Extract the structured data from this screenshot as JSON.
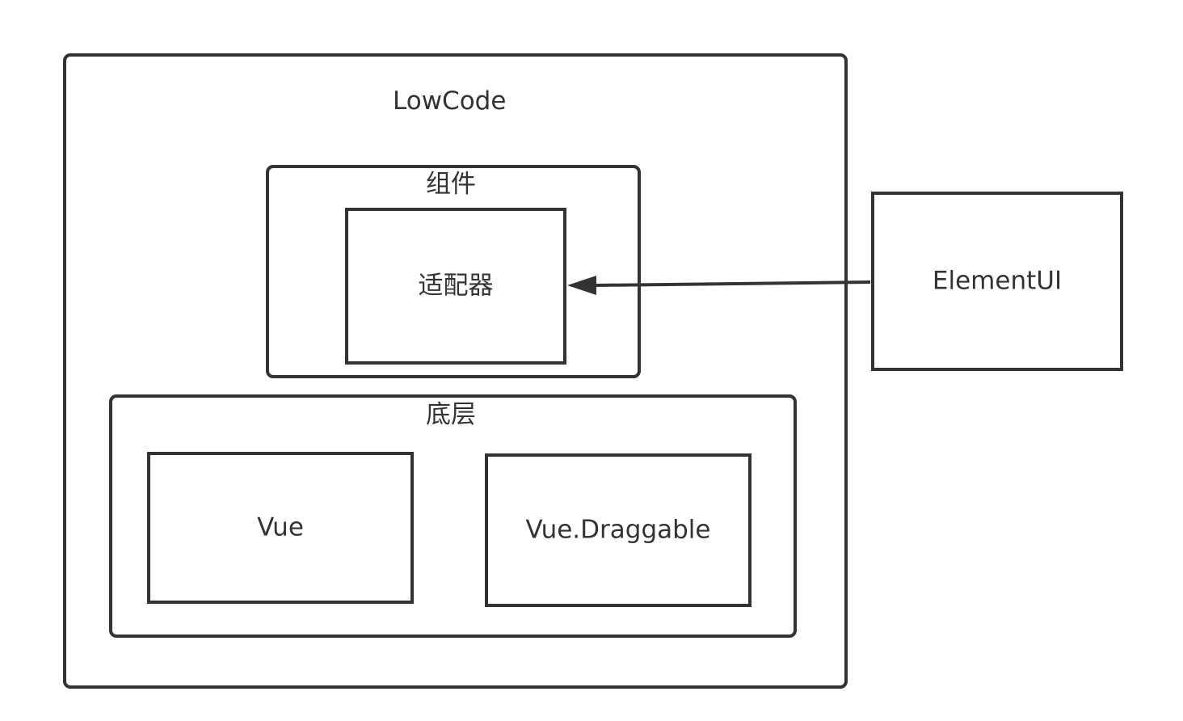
{
  "diagram": {
    "outer": {
      "label": "LowCode"
    },
    "component_group": {
      "label": "组件"
    },
    "adapter": {
      "label": "适配器"
    },
    "base_group": {
      "label": "底层"
    },
    "vue": {
      "label": "Vue"
    },
    "draggable": {
      "label": "Vue.Draggable"
    },
    "element_ui": {
      "label": "ElementUI"
    }
  },
  "colors": {
    "stroke": "#333333",
    "background": "#ffffff"
  },
  "edges": [
    {
      "from": "element_ui",
      "to": "adapter",
      "arrow": "filled-triangle"
    }
  ]
}
